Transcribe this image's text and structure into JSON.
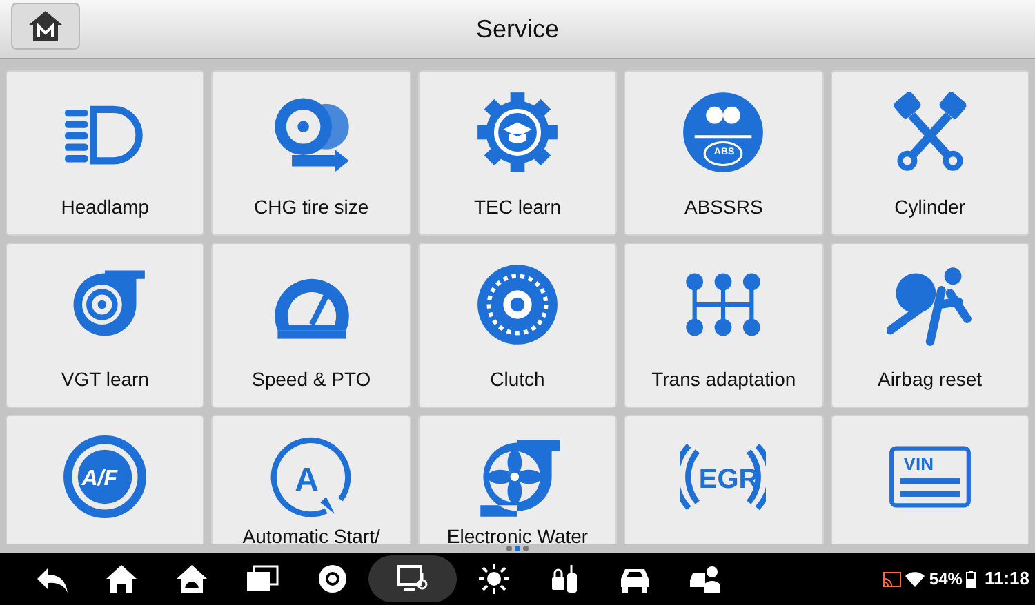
{
  "header": {
    "title": "Service"
  },
  "tiles": [
    {
      "label": "Headlamp"
    },
    {
      "label": "CHG tire size"
    },
    {
      "label": "TEC learn"
    },
    {
      "label": "ABSSRS",
      "icon_text": "ABS"
    },
    {
      "label": "Cylinder"
    },
    {
      "label": "VGT learn"
    },
    {
      "label": "Speed & PTO"
    },
    {
      "label": "Clutch"
    },
    {
      "label": "Trans adaptation"
    },
    {
      "label": "Airbag reset"
    },
    {
      "icon_text": "A/F"
    },
    {
      "label": "Automatic Start/",
      "icon_text": "A"
    },
    {
      "label": "Electronic Water"
    },
    {
      "icon_text": "EGR"
    },
    {
      "icon_text": "VIN"
    }
  ],
  "pager": [
    {
      "selected": false
    },
    {
      "selected": true
    },
    {
      "selected": false
    }
  ],
  "nav_bar": [
    {
      "selected": false
    },
    {
      "selected": false
    },
    {
      "selected": false
    },
    {
      "selected": false
    },
    {
      "selected": false
    },
    {
      "selected": true
    },
    {
      "selected": false
    },
    {
      "selected": false
    },
    {
      "selected": false
    },
    {
      "selected": false
    }
  ],
  "status": {
    "battery": "54%",
    "time": "11:18"
  }
}
